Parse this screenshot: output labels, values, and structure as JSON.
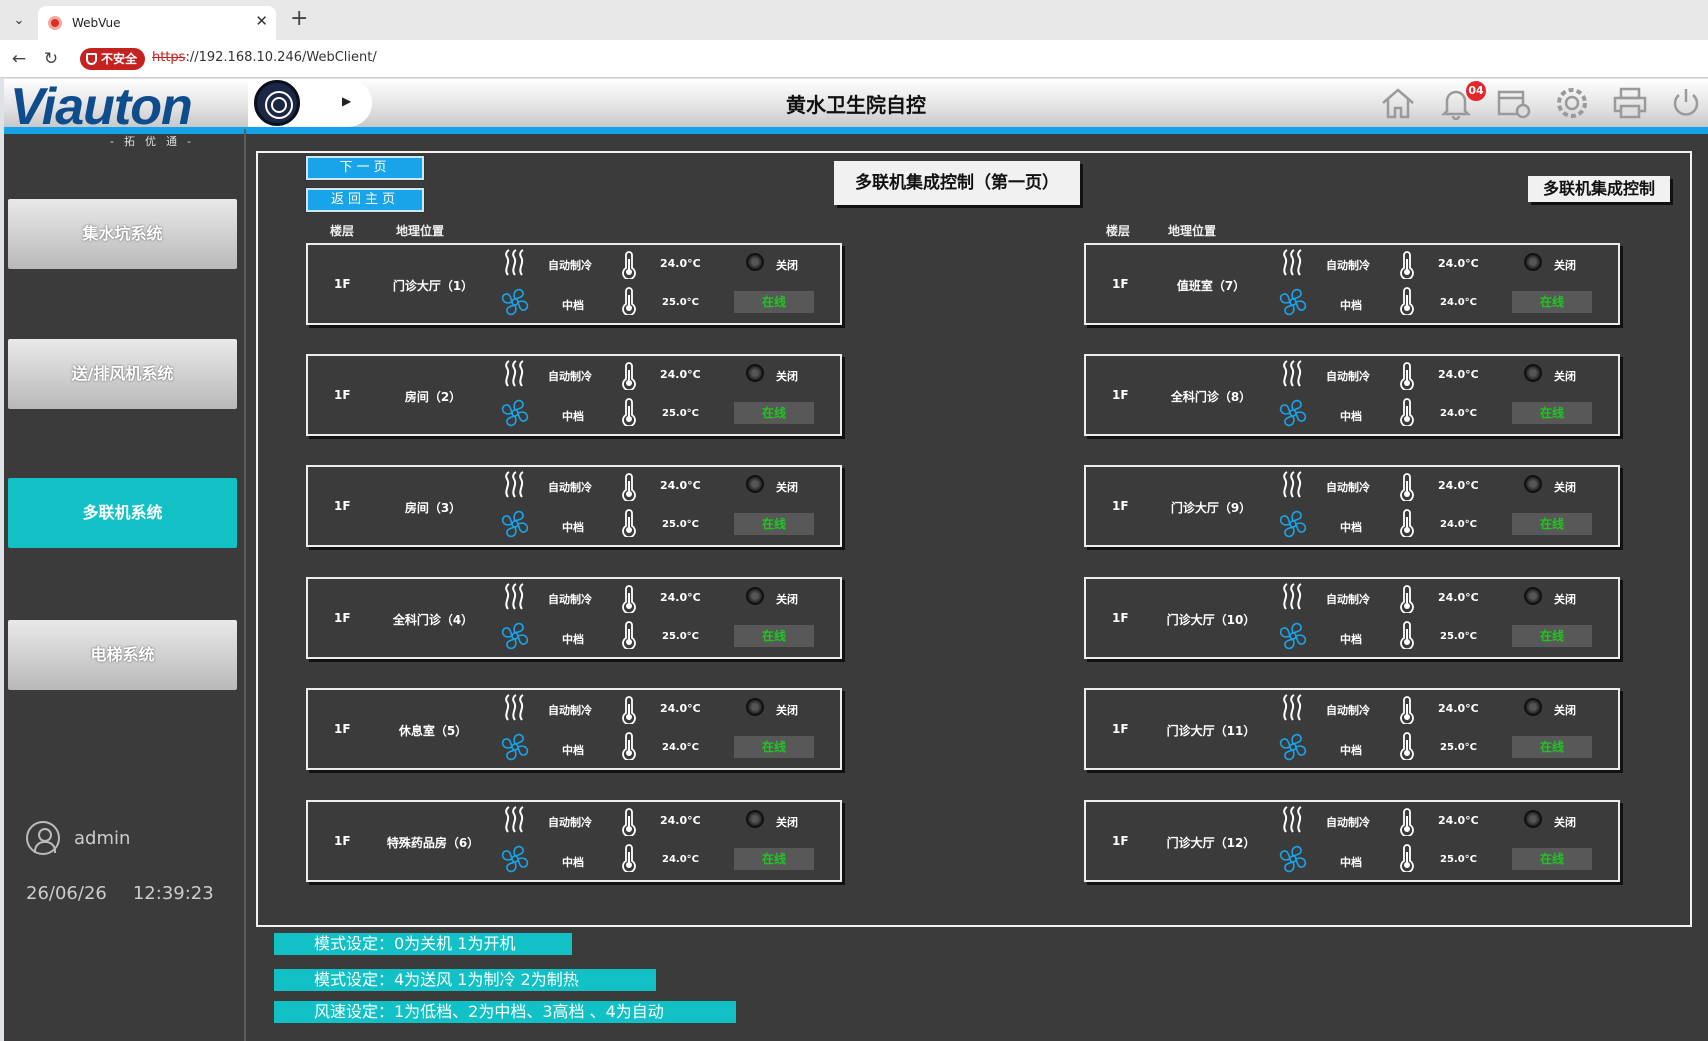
{
  "browser": {
    "tab_title": "WebVue",
    "tab_close": "✕",
    "new_tab": "+",
    "insecure_label": "不安全",
    "url_scheme": "https",
    "url_rest": "://192.168.10.246/WebClient/"
  },
  "header": {
    "logo_text": "Viauton",
    "logo_sub": "-拓优通-",
    "title": "黄水卫生院自控",
    "alarm_count": "04"
  },
  "sidebar": {
    "items": [
      {
        "label": "集水坑系统"
      },
      {
        "label": "送/排风机系统"
      },
      {
        "label": "多联机系统"
      },
      {
        "label": "电梯系统"
      }
    ],
    "user": "admin",
    "date": "26/06/26",
    "time": "12:39:23"
  },
  "main": {
    "next_page": "下一页",
    "back_home": "返回主页",
    "page_title": "多联机集成控制（第一页）",
    "panel_label": "多联机集成控制",
    "col_floor": "楼层",
    "col_location": "地理位置",
    "cards": [
      {
        "floor": "1F",
        "location": "门诊大厅（1）",
        "mode": "自动制冷",
        "speed": "中档",
        "temp_set": "24.0°C",
        "temp_room": "25.0°C",
        "power": "关闭",
        "status": "在线"
      },
      {
        "floor": "1F",
        "location": "房间（2）",
        "mode": "自动制冷",
        "speed": "中档",
        "temp_set": "24.0°C",
        "temp_room": "25.0°C",
        "power": "关闭",
        "status": "在线"
      },
      {
        "floor": "1F",
        "location": "房间（3）",
        "mode": "自动制冷",
        "speed": "中档",
        "temp_set": "24.0°C",
        "temp_room": "25.0°C",
        "power": "关闭",
        "status": "在线"
      },
      {
        "floor": "1F",
        "location": "全科门诊（4）",
        "mode": "自动制冷",
        "speed": "中档",
        "temp_set": "24.0°C",
        "temp_room": "25.0°C",
        "power": "关闭",
        "status": "在线"
      },
      {
        "floor": "1F",
        "location": "休息室（5）",
        "mode": "自动制冷",
        "speed": "中档",
        "temp_set": "24.0°C",
        "temp_room": "24.0°C",
        "power": "关闭",
        "status": "在线"
      },
      {
        "floor": "1F",
        "location": "特殊药品房（6）",
        "mode": "自动制冷",
        "speed": "中档",
        "temp_set": "24.0°C",
        "temp_room": "24.0°C",
        "power": "关闭",
        "status": "在线"
      },
      {
        "floor": "1F",
        "location": "值班室（7）",
        "mode": "自动制冷",
        "speed": "中档",
        "temp_set": "24.0°C",
        "temp_room": "24.0°C",
        "power": "关闭",
        "status": "在线"
      },
      {
        "floor": "1F",
        "location": "全科门诊（8）",
        "mode": "自动制冷",
        "speed": "中档",
        "temp_set": "24.0°C",
        "temp_room": "24.0°C",
        "power": "关闭",
        "status": "在线"
      },
      {
        "floor": "1F",
        "location": "门诊大厅（9）",
        "mode": "自动制冷",
        "speed": "中档",
        "temp_set": "24.0°C",
        "temp_room": "24.0°C",
        "power": "关闭",
        "status": "在线"
      },
      {
        "floor": "1F",
        "location": "门诊大厅（10）",
        "mode": "自动制冷",
        "speed": "中档",
        "temp_set": "24.0°C",
        "temp_room": "25.0°C",
        "power": "关闭",
        "status": "在线"
      },
      {
        "floor": "1F",
        "location": "门诊大厅（11）",
        "mode": "自动制冷",
        "speed": "中档",
        "temp_set": "24.0°C",
        "temp_room": "25.0°C",
        "power": "关闭",
        "status": "在线"
      },
      {
        "floor": "1F",
        "location": "门诊大厅（12）",
        "mode": "自动制冷",
        "speed": "中档",
        "temp_set": "24.0°C",
        "temp_room": "25.0°C",
        "power": "关闭",
        "status": "在线"
      }
    ]
  },
  "legends": [
    "模式设定：0为关机   1为开机",
    "模式设定：4为送风   1为制冷   2为制热",
    "风速设定：1为低档、2为中档、3高档 、4为自动"
  ],
  "colors": {
    "accent_cyan": "#11c1c5",
    "header_strip": "#14a3e8",
    "online_green": "#1fc61f",
    "panel_bg": "#3b3b3b"
  }
}
